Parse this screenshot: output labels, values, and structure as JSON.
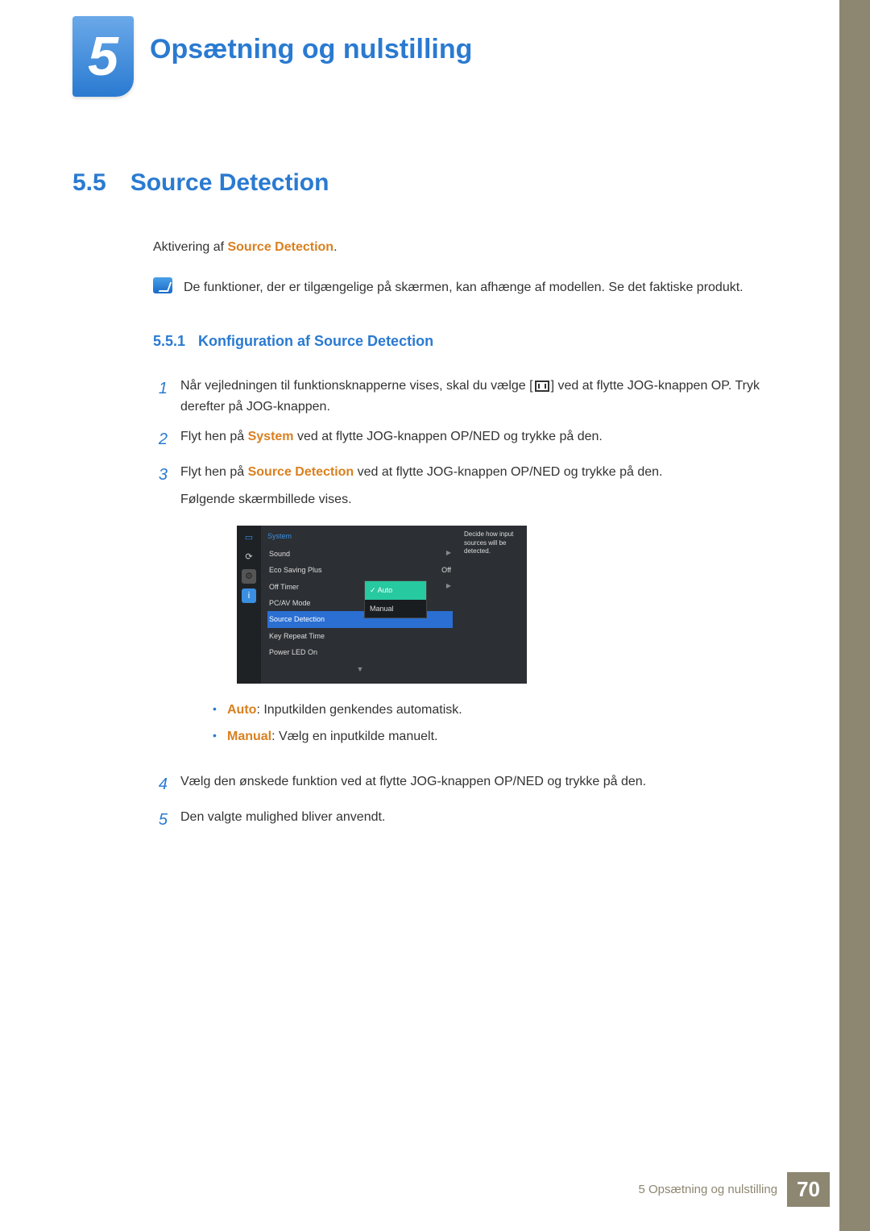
{
  "chapter": {
    "number": "5",
    "title": "Opsætning og nulstilling"
  },
  "section": {
    "number": "5.5",
    "title": "Source Detection"
  },
  "intro": {
    "prefix": "Aktivering af ",
    "term": "Source Detection",
    "suffix": "."
  },
  "note": "De funktioner, der er tilgængelige på skærmen, kan afhænge af modellen. Se det faktiske produkt.",
  "subsection": {
    "number": "5.5.1",
    "title": "Konfiguration af Source Detection"
  },
  "steps": {
    "s1a": "Når vejledningen til funktionsknapperne vises, skal du vælge [",
    "s1b": "] ved at flytte JOG-knappen OP. Tryk derefter på JOG-knappen.",
    "s2a": "Flyt hen på ",
    "s2term": "System",
    "s2b": " ved at flytte JOG-knappen OP/NED og trykke på den.",
    "s3a": "Flyt hen på ",
    "s3term": "Source Detection",
    "s3b": " ved at flytte JOG-knappen OP/NED og trykke på den.",
    "s3c": "Følgende skærmbillede vises.",
    "s4": "Vælg den ønskede funktion ved at flytte JOG-knappen OP/NED og trykke på den.",
    "s5": "Den valgte mulighed bliver anvendt."
  },
  "osd": {
    "title": "System",
    "rows": [
      {
        "label": "Sound",
        "value": "",
        "arrow": "▶"
      },
      {
        "label": "Eco Saving Plus",
        "value": "Off",
        "arrow": ""
      },
      {
        "label": "Off Timer",
        "value": "",
        "arrow": "▶"
      },
      {
        "label": "PC/AV Mode",
        "value": "",
        "arrow": ""
      },
      {
        "label": "Source Detection",
        "value": "",
        "arrow": "",
        "active": true
      },
      {
        "label": "Key Repeat Time",
        "value": "",
        "arrow": ""
      },
      {
        "label": "Power LED On",
        "value": "",
        "arrow": ""
      }
    ],
    "popup": {
      "selected": "Auto",
      "opt1": "Auto",
      "opt2": "Manual",
      "check": "✓"
    },
    "desc": "Decide how input sources will be detected."
  },
  "bullets": {
    "b1term": "Auto",
    "b1txt": ": Inputkilden genkendes automatisk.",
    "b2term": "Manual",
    "b2txt": ": Vælg en inputkilde manuelt."
  },
  "footer": {
    "text": "5 Opsætning og nulstilling",
    "page": "70"
  }
}
